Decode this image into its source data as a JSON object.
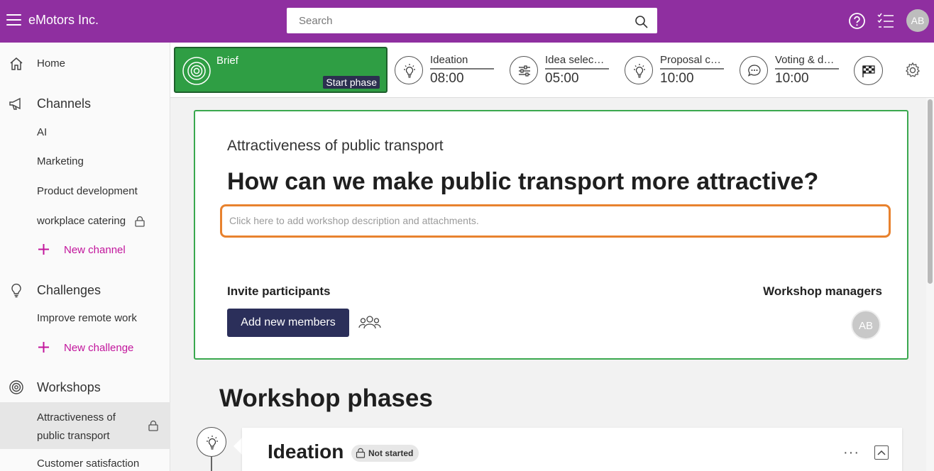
{
  "header": {
    "app_title": "eMotors Inc.",
    "search_placeholder": "Search",
    "avatar_initials": "AB"
  },
  "sidebar": {
    "home": "Home",
    "channels": {
      "title": "Channels",
      "items": [
        "AI",
        "Marketing",
        "Product development",
        "workplace catering"
      ],
      "new_label": "New channel"
    },
    "challenges": {
      "title": "Challenges",
      "items": [
        "Improve remote work"
      ],
      "new_label": "New challenge"
    },
    "workshops": {
      "title": "Workshops",
      "items": [
        "Attractiveness of public transport",
        "Customer satisfaction"
      ]
    }
  },
  "phasebar": {
    "brief": {
      "label": "Brief",
      "action": "Start phase"
    },
    "phases": [
      {
        "name": "Ideation",
        "time": "08:00",
        "icon": "lightbulb-icon"
      },
      {
        "name": "Idea selec…",
        "time": "05:00",
        "icon": "sliders-icon"
      },
      {
        "name": "Proposal c…",
        "time": "10:00",
        "icon": "lightbulb-icon"
      },
      {
        "name": "Voting & d…",
        "time": "10:00",
        "icon": "chat-icon"
      }
    ]
  },
  "workshop": {
    "subtitle": "Attractiveness of public transport",
    "title": "How can we make public transport more attractive?",
    "description_placeholder": "Click here to add workshop description and attachments.",
    "invite_label": "Invite participants",
    "add_members_label": "Add new members",
    "managers_label": "Workshop managers",
    "manager_initials": "AB"
  },
  "phases_section": {
    "heading": "Workshop phases",
    "first_phase": {
      "title": "Ideation",
      "status": "Not started",
      "more": "···"
    }
  },
  "colors": {
    "topbar": "#8f2fa0",
    "brief_green": "#2f9e44",
    "accent_pink": "#c2159c",
    "highlight_orange": "#e8822e",
    "button_navy": "#2b2f5a"
  }
}
